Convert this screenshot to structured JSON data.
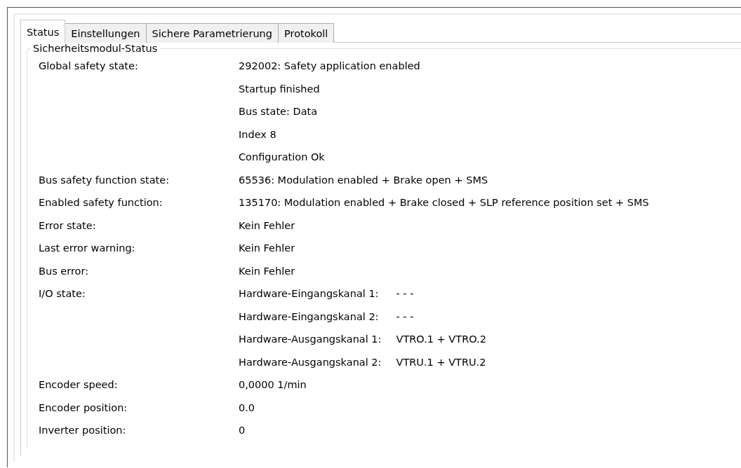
{
  "tabs": [
    {
      "label": "Status",
      "selected": true
    },
    {
      "label": "Einstellungen",
      "selected": false
    },
    {
      "label": "Sichere Parametrierung",
      "selected": false
    },
    {
      "label": "Protokoll",
      "selected": false
    }
  ],
  "group": {
    "title": "Sicherheitsmodul-Status",
    "rows": [
      {
        "kind": "text",
        "label": "Global safety state:",
        "values": [
          "292002: Safety application enabled",
          "Startup finished",
          "Bus state: Data",
          "Index 8",
          "Configuration Ok"
        ]
      },
      {
        "kind": "text",
        "label": "Bus safety function state:",
        "values": [
          "65536: Modulation enabled + Brake open + SMS"
        ]
      },
      {
        "kind": "text",
        "label": "Enabled safety function:",
        "values": [
          "135170: Modulation enabled + Brake closed + SLP reference position set + SMS"
        ]
      },
      {
        "kind": "text",
        "label": "Error state:",
        "values": [
          "Kein Fehler"
        ]
      },
      {
        "kind": "text",
        "label": "Last error warning:",
        "values": [
          "Kein Fehler"
        ]
      },
      {
        "kind": "text",
        "label": "Bus error:",
        "values": [
          "Kein Fehler"
        ]
      },
      {
        "kind": "channels",
        "label": "I/O state:",
        "channels": [
          {
            "name": "Hardware-Eingangskanal 1:",
            "value": "- - -"
          },
          {
            "name": "Hardware-Eingangskanal 2:",
            "value": "- - -"
          },
          {
            "name": "Hardware-Ausgangskanal 1:",
            "value": "VTRO.1 + VTRO.2"
          },
          {
            "name": "Hardware-Ausgangskanal 2:",
            "value": "VTRU.1 + VTRU.2"
          }
        ]
      },
      {
        "kind": "text",
        "label": "Encoder speed:",
        "values": [
          "0,0000 1/min"
        ]
      },
      {
        "kind": "text",
        "label": "Encoder position:",
        "values": [
          "0.0"
        ]
      },
      {
        "kind": "text",
        "label": "Inverter position:",
        "values": [
          "0"
        ]
      }
    ]
  }
}
